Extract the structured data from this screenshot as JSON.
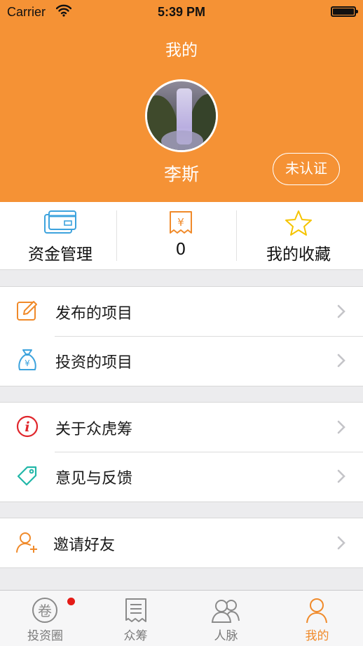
{
  "status_bar": {
    "carrier": "Carrier",
    "time": "5:39 PM"
  },
  "header": {
    "title": "我的",
    "username": "李斯",
    "verify_status": "未认证",
    "background_color": "#f59235"
  },
  "stats": [
    {
      "label": "资金管理",
      "icon": "card-icon"
    },
    {
      "label": "0",
      "icon": "receipt-yen-icon"
    },
    {
      "label": "我的收藏",
      "icon": "star-icon"
    }
  ],
  "menu": {
    "group1": [
      {
        "label": "发布的项目",
        "icon": "edit-icon"
      },
      {
        "label": "投资的项目",
        "icon": "money-bag-icon"
      }
    ],
    "group2": [
      {
        "label": "关于众虎筹",
        "icon": "info-icon"
      },
      {
        "label": "意见与反馈",
        "icon": "tag-icon"
      }
    ],
    "group3": [
      {
        "label": "邀请好友",
        "icon": "add-user-icon"
      }
    ]
  },
  "tabbar": [
    {
      "label": "投资圈",
      "icon": "circle-juan-icon",
      "has_badge": true
    },
    {
      "label": "众筹",
      "icon": "document-icon"
    },
    {
      "label": "人脉",
      "icon": "contacts-icon"
    },
    {
      "label": "我的",
      "icon": "person-icon",
      "active": true
    }
  ],
  "colors": {
    "accent": "#f59235",
    "tab_active": "#f08a2a",
    "badge": "#e41b17"
  }
}
